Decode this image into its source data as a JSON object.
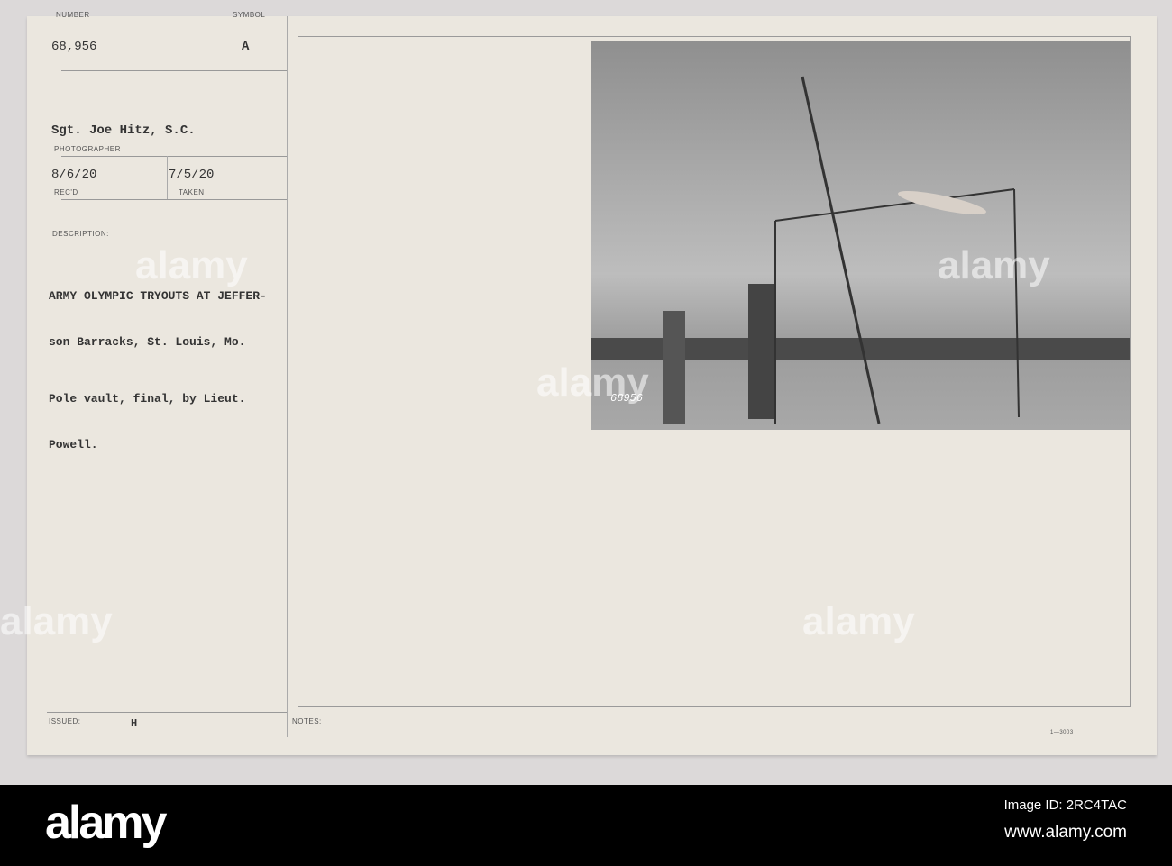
{
  "card": {
    "number_label": "NUMBER",
    "number": "68,956",
    "symbol_label": "SYMBOL",
    "symbol": "A",
    "photographer": "Sgt. Joe Hitz, S.C.",
    "photographer_label": "PHOTOGRAPHER",
    "received": "8/6/20",
    "received_label": "REC'D",
    "taken": "7/5/20",
    "taken_label": "TAKEN",
    "description_label": "DESCRIPTION:",
    "description_line1": "ARMY OLYMPIC TRYOUTS AT JEFFER-",
    "description_line2": "son Barracks, St. Louis, Mo.",
    "description_line3": "Pole vault, final, by Lieut.",
    "description_line4": "Powell.",
    "issued_label": "ISSUED:",
    "issued_mark": "H",
    "notes_label": "NOTES:",
    "form_code": "1—3003",
    "photo_number": "68956"
  },
  "watermark": {
    "brand": "alamy",
    "image_id": "Image ID: 2RC4TAC",
    "url": "www.alamy.com"
  }
}
